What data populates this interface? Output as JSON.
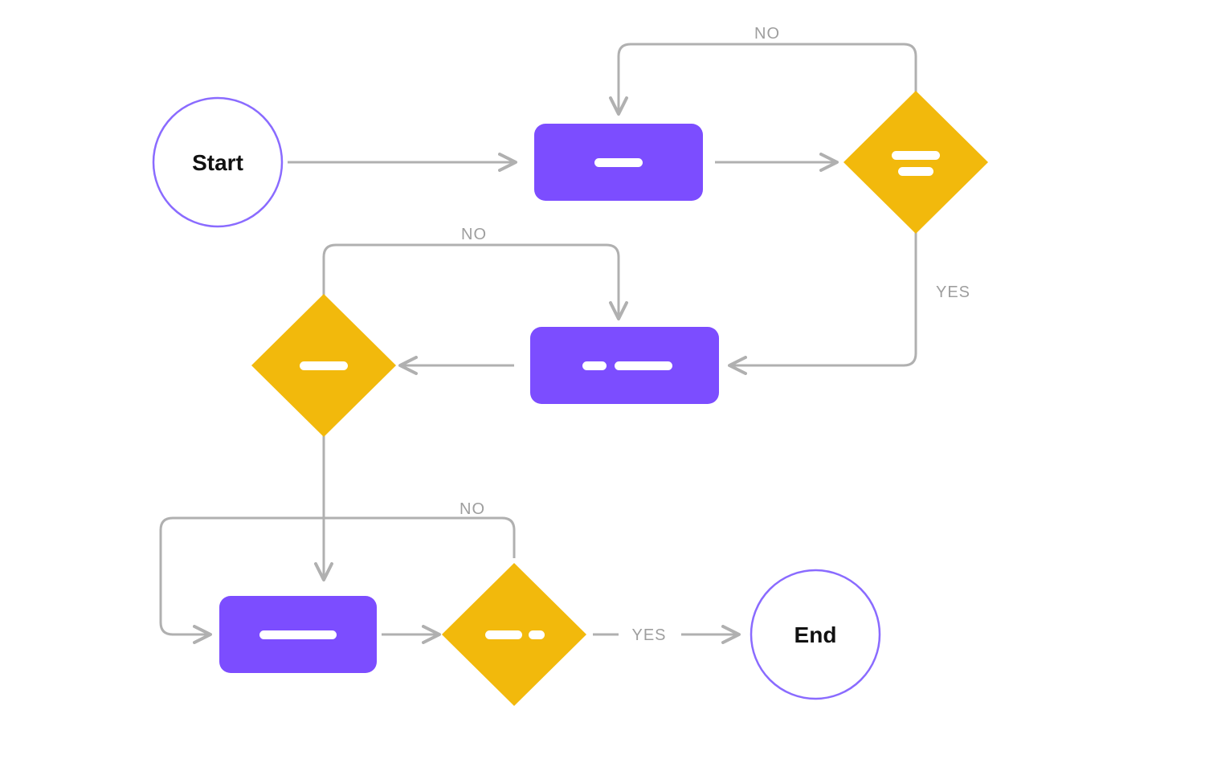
{
  "colors": {
    "process": "#7C4DFF",
    "decision": "#F2B90C",
    "terminal_stroke": "#8A6BFF",
    "edge": "#B0B0B0",
    "edge_label": "#9E9E9E",
    "text": "#111111",
    "white": "#FFFFFF"
  },
  "nodes": {
    "start": {
      "type": "terminal",
      "label": "Start"
    },
    "p1": {
      "type": "process"
    },
    "d1": {
      "type": "decision"
    },
    "p2": {
      "type": "process"
    },
    "d2": {
      "type": "decision"
    },
    "p3": {
      "type": "process"
    },
    "d3": {
      "type": "decision"
    },
    "end": {
      "type": "terminal",
      "label": "End"
    }
  },
  "edges": {
    "start_p1": {
      "from": "start",
      "to": "p1",
      "label": ""
    },
    "p1_d1": {
      "from": "p1",
      "to": "d1",
      "label": ""
    },
    "d1_p1_no": {
      "from": "d1",
      "to": "p1",
      "label": "NO"
    },
    "d1_p2_yes": {
      "from": "d1",
      "to": "p2",
      "label": "YES"
    },
    "p2_d2": {
      "from": "p2",
      "to": "d2",
      "label": ""
    },
    "d2_p2_no": {
      "from": "d2",
      "to": "p2",
      "label": "NO"
    },
    "d2_p3": {
      "from": "d2",
      "to": "p3",
      "label": ""
    },
    "p3_d3": {
      "from": "p3",
      "to": "d3",
      "label": ""
    },
    "d3_p3_no": {
      "from": "d3",
      "to": "p3",
      "label": "NO"
    },
    "d3_end_yes": {
      "from": "d3",
      "to": "end",
      "label": "YES"
    }
  }
}
